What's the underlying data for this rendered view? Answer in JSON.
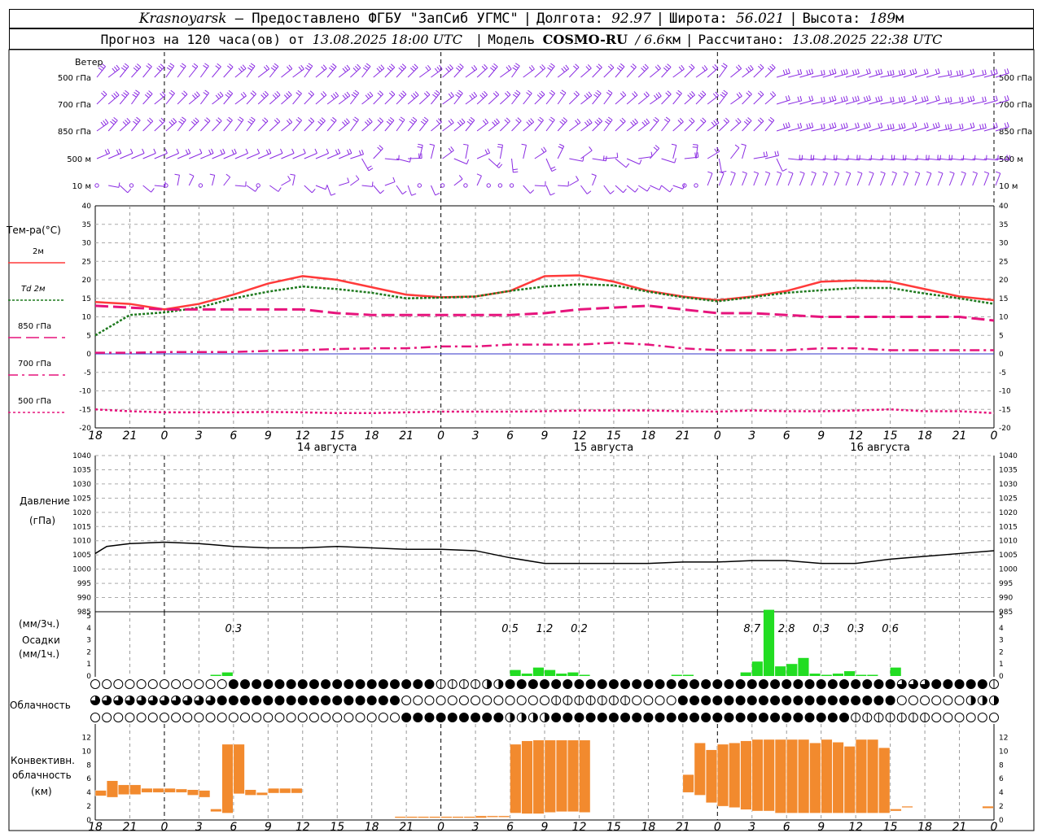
{
  "header": {
    "station": "Krasnoyarsk",
    "provider": "— Предоставлено ФГБУ \"ЗапСиб УГМС\"",
    "lon_label": "Долгота:",
    "lon": "92.97",
    "lat_label": "Широта:",
    "lat": "56.021",
    "alt_label": "Высота:",
    "alt": "189",
    "alt_unit": "м",
    "forecast_prefix": "Прогноз на 120 часа(ов) от",
    "forecast_from": "13.08.2025 18:00 UTC",
    "model_label": "Модель",
    "model": "COSMO-RU",
    "model_res": "/ 6.6",
    "model_res_unit": "км",
    "calc_label": "Рассчитано:",
    "calc_time": "13.08.2025 22:38 UTC"
  },
  "wind": {
    "title": "Ветер",
    "levels": [
      "500 гПа",
      "700 гПа",
      "850 гПа",
      "500 м",
      "10 м"
    ]
  },
  "temperature": {
    "title": "Тем-ра(°С)",
    "legend": [
      {
        "label": "2м",
        "color": "#ff3a3a"
      },
      {
        "label": "Td 2м",
        "color": "#1f7a1f"
      },
      {
        "label": "850 гПа",
        "color": "#e6147c"
      },
      {
        "label": "700 гПа",
        "color": "#e6147c"
      },
      {
        "label": "500 гПа",
        "color": "#e6147c"
      }
    ]
  },
  "time_axis": {
    "ticks": [
      "18",
      "21",
      "0",
      "3",
      "6",
      "9",
      "12",
      "15",
      "18",
      "21",
      "0",
      "3",
      "6",
      "9",
      "12",
      "15",
      "18",
      "21",
      "0",
      "3",
      "6",
      "9",
      "12",
      "15",
      "18",
      "21",
      "0"
    ],
    "days": [
      "14 августа",
      "15 августа",
      "16 августа"
    ]
  },
  "pressure": {
    "title": "Давление",
    "unit": "(гПа)"
  },
  "precip": {
    "unit3": "(мм/3ч.)",
    "title": "Осадки",
    "unit1": "(мм/1ч.)",
    "totals": [
      {
        "hour": 12,
        "text": "0.3"
      },
      {
        "hour": 36,
        "text": "0.5"
      },
      {
        "hour": 39,
        "text": "1.2"
      },
      {
        "hour": 42,
        "text": "0.2"
      },
      {
        "hour": 57,
        "text": "8.7"
      },
      {
        "hour": 60,
        "text": "2.8"
      },
      {
        "hour": 63,
        "text": "0.3"
      },
      {
        "hour": 66,
        "text": "0.3"
      },
      {
        "hour": 69,
        "text": "0.6"
      }
    ]
  },
  "cloudiness": {
    "title": "Облачность"
  },
  "convective": {
    "title1": "Конвективн.",
    "title2": "облачность",
    "unit": "(км)"
  },
  "colors": {
    "temp2m": "#ff3a3a",
    "dew": "#1f7a1f",
    "upper": "#e6147c",
    "wind": "#8a2be2",
    "precip": "#22dd22",
    "conv": "#f28a2e"
  },
  "chart_data": [
    {
      "type": "line",
      "title": "Тем-ра(°С)",
      "x_hours_from_start": [
        0,
        3,
        6,
        9,
        12,
        15,
        18,
        21,
        24,
        27,
        30,
        33,
        36,
        39,
        42,
        45,
        48,
        51,
        54,
        57,
        60,
        63,
        66,
        69,
        72,
        75,
        78
      ],
      "ylim": [
        -20,
        40
      ],
      "series": [
        {
          "name": "2м",
          "values": [
            14,
            13.5,
            12,
            13.5,
            16,
            19,
            21,
            20,
            18,
            16,
            15.3,
            15.5,
            17,
            21,
            21.2,
            19.5,
            17,
            15.5,
            14.5,
            15.5,
            17,
            19.5,
            19.8,
            19.5,
            17.5,
            15.5,
            14.5
          ]
        },
        {
          "name": "Td 2м",
          "values": [
            5,
            10.5,
            11.2,
            12.5,
            15,
            16.8,
            18.2,
            17.5,
            16.5,
            15,
            15.2,
            15.5,
            17,
            18.2,
            18.8,
            18.5,
            16.8,
            15.3,
            14.2,
            15.3,
            16.5,
            17.2,
            17.8,
            17.8,
            16.3,
            15,
            13.5
          ]
        },
        {
          "name": "850 гПа",
          "values": [
            13,
            12.5,
            12,
            12,
            12,
            12,
            12,
            11,
            10.5,
            10.5,
            10.5,
            10.5,
            10.5,
            11,
            12,
            12.5,
            13,
            12,
            11,
            11,
            10.5,
            10,
            10,
            10,
            10,
            10,
            9
          ]
        },
        {
          "name": "700 гПа",
          "values": [
            0.3,
            0.3,
            0.5,
            0.5,
            0.5,
            0.8,
            1,
            1.3,
            1.5,
            1.5,
            2,
            2,
            2.5,
            2.5,
            2.5,
            3,
            2.5,
            1.5,
            1,
            1,
            1,
            1.5,
            1.5,
            1,
            1,
            1,
            1
          ]
        },
        {
          "name": "500 гПа",
          "values": [
            -15,
            -15.5,
            -15.8,
            -15.8,
            -15.8,
            -15.7,
            -15.8,
            -16,
            -16,
            -15.8,
            -15.6,
            -15.6,
            -15.6,
            -15.5,
            -15.3,
            -15.3,
            -15.3,
            -15.5,
            -15.6,
            -15.3,
            -15.5,
            -15.5,
            -15.3,
            -15,
            -15.5,
            -15.5,
            -16
          ]
        }
      ]
    },
    {
      "type": "line",
      "title": "Давление",
      "x_hours_from_start": [
        0,
        1,
        3,
        6,
        9,
        12,
        15,
        18,
        21,
        24,
        27,
        30,
        33,
        36,
        39,
        42,
        45,
        48,
        51,
        54,
        57,
        60,
        63,
        66,
        69,
        72,
        75,
        78
      ],
      "ylim": [
        985,
        1040
      ],
      "series": [
        {
          "name": "Давление",
          "values": [
            1005.5,
            1008,
            1009,
            1009.5,
            1009,
            1008,
            1007.5,
            1007.5,
            1008,
            1007.5,
            1007,
            1007,
            1006.5,
            1004,
            1002,
            1002,
            1002,
            1002,
            1002.5,
            1002.5,
            1003,
            1003,
            1002,
            1002,
            1003.5,
            1004.5,
            1005.5,
            1006.5
          ]
        }
      ]
    },
    {
      "type": "bar",
      "title": "Осадки",
      "ylim": [
        0,
        5
      ],
      "x_hours_from_start": [
        10,
        11,
        36,
        37,
        38,
        39,
        40,
        41,
        42,
        50,
        51,
        56,
        57,
        58,
        59,
        60,
        61,
        62,
        63,
        64,
        65,
        66,
        67,
        69
      ],
      "values": [
        0.1,
        0.3,
        0.5,
        0.2,
        0.7,
        0.5,
        0.2,
        0.3,
        0.1,
        0.1,
        0.1,
        0.3,
        1.2,
        5.5,
        0.8,
        1.0,
        1.5,
        0.2,
        0.1,
        0.2,
        0.4,
        0.1,
        0.1,
        0.7
      ]
    },
    {
      "type": "bar",
      "title": "Конвективн. облачность",
      "ylim": [
        0,
        12
      ],
      "x_hours_from_start": [
        0,
        1,
        2,
        3,
        4,
        5,
        6,
        7,
        8,
        9,
        10,
        11,
        12,
        13,
        14,
        15,
        16,
        17,
        26,
        27,
        28,
        29,
        30,
        31,
        32,
        33,
        34,
        35,
        36,
        37,
        38,
        39,
        40,
        41,
        42,
        51,
        52,
        53,
        54,
        55,
        56,
        57,
        58,
        59,
        60,
        61,
        62,
        63,
        64,
        65,
        66,
        67,
        68,
        69,
        70,
        77
      ],
      "bottom": [
        3.5,
        3.3,
        3.7,
        3.7,
        4.0,
        4.0,
        4.0,
        4.0,
        3.6,
        3.3,
        1.2,
        1.0,
        3.8,
        3.6,
        3.6,
        3.9,
        3.9,
        3.9,
        0.3,
        0.3,
        0.3,
        0.3,
        0.3,
        0.3,
        0.3,
        0.3,
        0.4,
        0.4,
        1.0,
        0.9,
        0.9,
        1.1,
        1.2,
        1.2,
        1.1,
        4.0,
        3.6,
        2.5,
        2.0,
        1.8,
        1.5,
        1.3,
        1.3,
        1.0,
        1.0,
        1.0,
        1.0,
        1.0,
        1.0,
        1.0,
        1.0,
        1.0,
        1.0,
        1.3,
        1.8,
        1.7
      ],
      "top": [
        4.3,
        5.7,
        5.1,
        5.1,
        4.6,
        4.6,
        4.6,
        4.5,
        4.4,
        4.3,
        1.6,
        11.0,
        11.0,
        4.4,
        4.0,
        4.6,
        4.6,
        4.6,
        0.5,
        0.5,
        0.5,
        0.5,
        0.5,
        0.5,
        0.5,
        0.6,
        0.6,
        0.6,
        11.0,
        11.5,
        11.6,
        11.6,
        11.6,
        11.6,
        11.6,
        6.6,
        11.2,
        10.2,
        11.0,
        11.2,
        11.5,
        11.7,
        11.7,
        11.7,
        11.7,
        11.7,
        11.2,
        11.7,
        11.3,
        10.7,
        11.7,
        11.7,
        10.5,
        1.6,
        2.0,
        2.0
      ]
    }
  ]
}
